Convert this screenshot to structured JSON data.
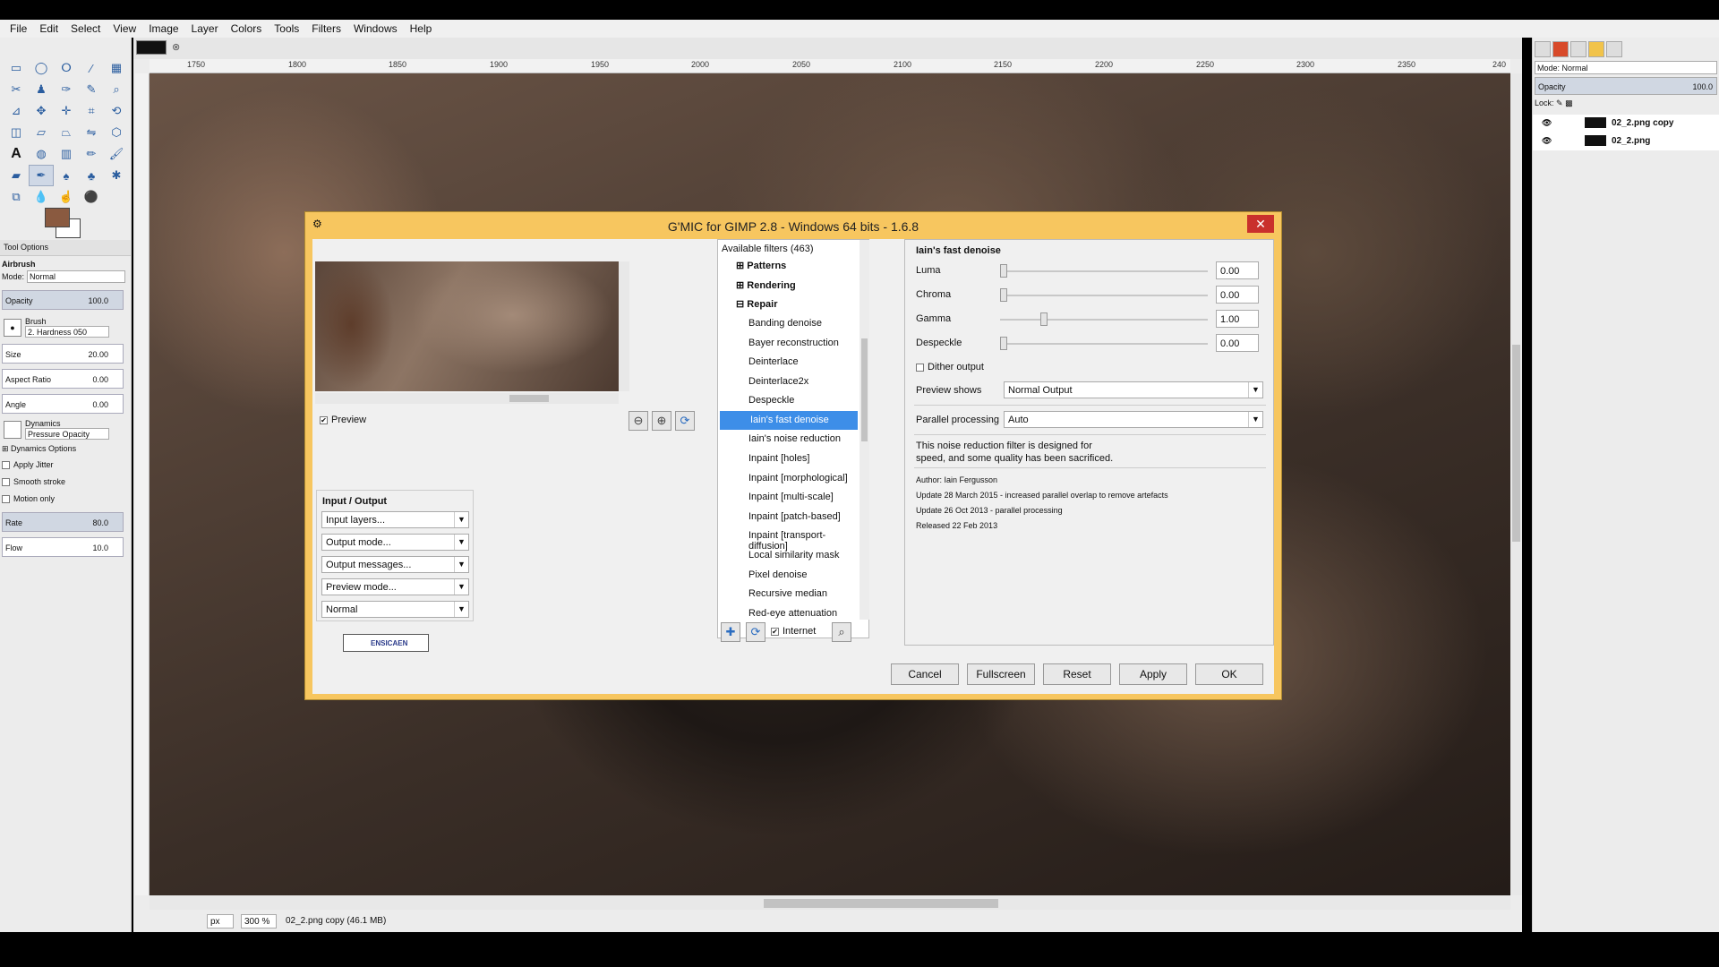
{
  "menubar": [
    "File",
    "Edit",
    "Select",
    "View",
    "Image",
    "Layer",
    "Colors",
    "Tools",
    "Filters",
    "Windows",
    "Help"
  ],
  "tool_options": {
    "tab_label": "Tool Options",
    "tool_name": "Airbrush",
    "mode_label": "Mode:",
    "mode_value": "Normal",
    "opacity_label": "Opacity",
    "opacity_value": "100.0",
    "brush_label": "Brush",
    "brush_value": "2. Hardness 050",
    "size_label": "Size",
    "size_value": "20.00",
    "aspect_label": "Aspect Ratio",
    "aspect_value": "0.00",
    "angle_label": "Angle",
    "angle_value": "0.00",
    "dynamics_label": "Dynamics",
    "dynamics_value": "Pressure Opacity",
    "dynamics_options": "Dynamics Options",
    "apply_jitter": "Apply Jitter",
    "smooth_stroke": "Smooth stroke",
    "motion_only": "Motion only",
    "rate_label": "Rate",
    "rate_value": "80.0",
    "flow_label": "Flow",
    "flow_value": "10.0"
  },
  "ruler_labels": [
    "1750",
    "1800",
    "1850",
    "1900",
    "1950",
    "2000",
    "2050",
    "2100",
    "2150",
    "2200",
    "2250",
    "2300",
    "2350",
    "240"
  ],
  "status": {
    "unit": "px",
    "zoom": "300 %",
    "info": "02_2.png copy (46.1 MB)"
  },
  "layers_panel": {
    "mode_label": "Mode: Normal",
    "opacity_label": "Opacity",
    "opacity_value": "100.0",
    "lock_label": "Lock:",
    "layers": [
      "02_2.png copy",
      "02_2.png"
    ]
  },
  "dialog": {
    "title": "G'MIC for GIMP 2.8 - Windows 64 bits - 1.6.8",
    "preview_label": "Preview",
    "io_title": "Input / Output",
    "io_dropdowns": [
      "Input layers...",
      "Output mode...",
      "Output messages...",
      "Preview mode...",
      "Normal"
    ],
    "logo_text": "ENSICAEN",
    "filter_header": "Available filters (463)",
    "categories": [
      "Patterns",
      "Rendering",
      "Repair"
    ],
    "filters": [
      "Banding denoise",
      "Bayer reconstruction",
      "Deinterlace",
      "Deinterlace2x",
      "Despeckle",
      "Iain's fast denoise",
      "Iain's noise reduction",
      "Inpaint [holes]",
      "Inpaint [morphological]",
      "Inpaint [multi-scale]",
      "Inpaint [patch-based]",
      "Inpaint [transport-diffusion]",
      "Local similarity mask",
      "Pixel denoise",
      "Recursive median",
      "Red-eye attenuation"
    ],
    "selected_filter": "Iain's fast denoise",
    "internet_label": "Internet",
    "params_title": "Iain's fast denoise",
    "params": [
      {
        "label": "Luma",
        "value": "0.00",
        "level": 0.0
      },
      {
        "label": "Chroma",
        "value": "0.00",
        "level": 0.0
      },
      {
        "label": "Gamma",
        "value": "1.00",
        "level": 0.2
      },
      {
        "label": "Despeckle",
        "value": "0.00",
        "level": 0.0
      }
    ],
    "dither_label": "Dither output",
    "preview_shows_label": "Preview shows",
    "preview_shows_value": "Normal Output",
    "parallel_label": "Parallel processing",
    "parallel_value": "Auto",
    "desc_line1": "This noise reduction filter is designed for",
    "desc_line2": "speed, and some quality has been sacrificed.",
    "author": "Author: Iain Fergusson",
    "update1": "Update 28 March 2015 - increased parallel overlap to remove artefacts",
    "update2": "Update 26 Oct 2013 - parallel processing",
    "released": "Released 22 Feb 2013",
    "buttons": {
      "cancel": "Cancel",
      "fullscreen": "Fullscreen",
      "reset": "Reset",
      "apply": "Apply",
      "ok": "OK"
    }
  }
}
